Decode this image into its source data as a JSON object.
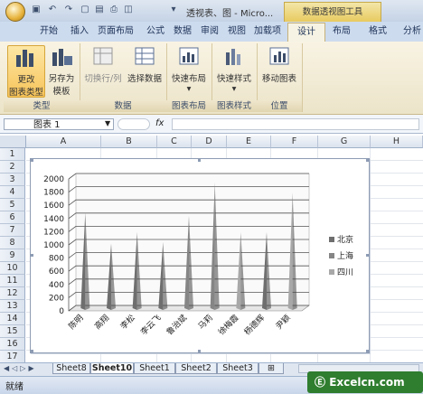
{
  "titlebar": {
    "doc_title": "透视表、图 - Micro...",
    "context_tool": "数据透视图工具"
  },
  "tabs": [
    "开始",
    "插入",
    "页面布局",
    "公式",
    "数据",
    "审阅",
    "视图",
    "加载项",
    "设计",
    "布局",
    "格式",
    "分析"
  ],
  "active_tab": "设计",
  "ribbon": {
    "groups": {
      "type": "类型",
      "data": "数据",
      "chart_layout": "图表布局",
      "chart_style": "图表样式",
      "location": "位置"
    },
    "buttons": {
      "change_chart_type_1": "更改",
      "change_chart_type_2": "图表类型",
      "save_template_1": "另存为",
      "save_template_2": "模板",
      "switch_row_col": "切换行/列",
      "select_data": "选择数据",
      "quick_layout": "快速布局",
      "quick_style": "快速样式",
      "move_chart": "移动图表"
    }
  },
  "formula_bar": {
    "name_box": "图表 1",
    "fx": "fx"
  },
  "columns": [
    "A",
    "B",
    "C",
    "D",
    "E",
    "F",
    "G",
    "H"
  ],
  "rows": [
    "1",
    "2",
    "3",
    "4",
    "5",
    "6",
    "7",
    "8",
    "9",
    "10",
    "11",
    "12",
    "13",
    "14",
    "15",
    "16",
    "17"
  ],
  "sheet_tabs": [
    "Sheet8",
    "Sheet10",
    "Sheet1",
    "Sheet2",
    "Sheet3"
  ],
  "active_sheet": "Sheet10",
  "status": "就绪",
  "watermark": "Excelcn.com",
  "chart_data": {
    "type": "bar",
    "categories": [
      "陈明",
      "高翔",
      "李松",
      "李云飞",
      "鲁治斌",
      "马莉",
      "徐梅霞",
      "杨德辉",
      "尹颖"
    ],
    "series": [
      {
        "name": "北京",
        "values": [
          1450,
          980,
          1150,
          1000,
          null,
          null,
          null,
          1150,
          null
        ],
        "color": "#6e6e6e"
      },
      {
        "name": "上海",
        "values": [
          null,
          null,
          null,
          null,
          1400,
          1900,
          null,
          null,
          null
        ],
        "color": "#858585"
      },
      {
        "name": "四川",
        "values": [
          null,
          null,
          null,
          null,
          null,
          null,
          1150,
          null,
          1750
        ],
        "color": "#a8a8a8"
      }
    ],
    "yticks": [
      "0",
      "200",
      "400",
      "600",
      "800",
      "1000",
      "1200",
      "1400",
      "1600",
      "1800",
      "2000"
    ],
    "ylim": [
      0,
      2000
    ],
    "legend": "right",
    "grid": true
  }
}
